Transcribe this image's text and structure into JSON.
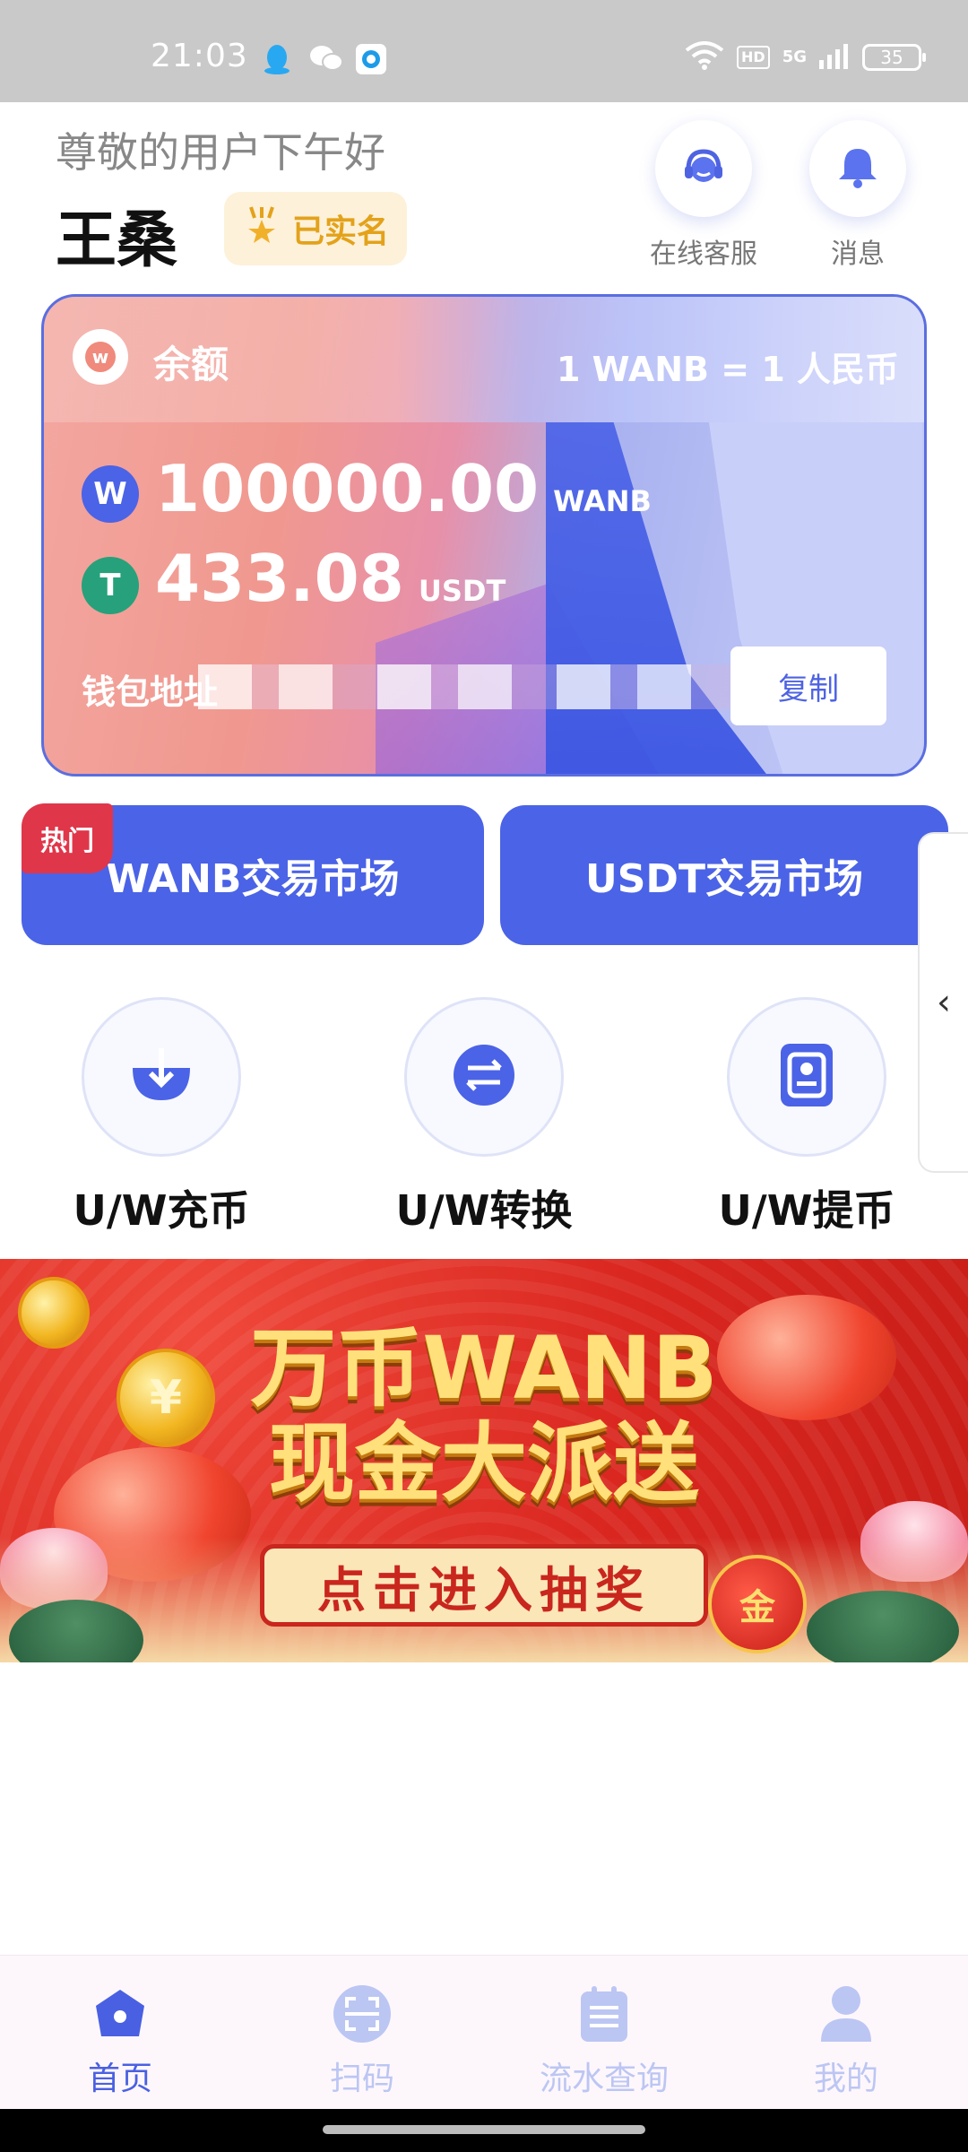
{
  "status_bar": {
    "time": "21:03",
    "network": "5G",
    "hd_label": "HD",
    "battery": "35"
  },
  "header": {
    "greeting": "尊敬的用户下午好",
    "username": "王桑",
    "verified_label": "已实名",
    "customer_service_label": "在线客服",
    "messages_label": "消息"
  },
  "balance_card": {
    "title": "余额",
    "rate": "1 WANB = 1 人民币",
    "wanb_coin_letter": "W",
    "wanb_amount": "100000.00",
    "wanb_unit": "WANB",
    "usdt_coin_letter": "T",
    "usdt_amount": "433.08",
    "usdt_unit": "USDT",
    "wallet_label": "钱包地址",
    "copy_label": "复制",
    "logo_letter": "w"
  },
  "markets": {
    "hot_badge": "热门",
    "wanb_market": "WANB交易市场",
    "usdt_market": "USDT交易市场"
  },
  "side_tab": {
    "arrow": "‹"
  },
  "actions": [
    {
      "label": "U/W充币",
      "icon": "deposit-icon"
    },
    {
      "label": "U/W转换",
      "icon": "exchange-icon"
    },
    {
      "label": "U/W提币",
      "icon": "withdraw-icon"
    }
  ],
  "banner": {
    "line1": "万币WANB",
    "line2": "现金大派送",
    "cta": "点击进入抽奖",
    "bag_text": "金",
    "coin_text": "¥"
  },
  "bottom_nav": [
    {
      "label": "首页",
      "icon": "home-icon",
      "active": true
    },
    {
      "label": "扫码",
      "icon": "scan-icon",
      "active": false
    },
    {
      "label": "流水查询",
      "icon": "ledger-icon",
      "active": false
    },
    {
      "label": "我的",
      "icon": "profile-icon",
      "active": false
    }
  ],
  "colors": {
    "primary": "#4b63e6",
    "hot": "#e0364a",
    "verified": "#e3a21a",
    "banner_red": "#d9261f"
  }
}
